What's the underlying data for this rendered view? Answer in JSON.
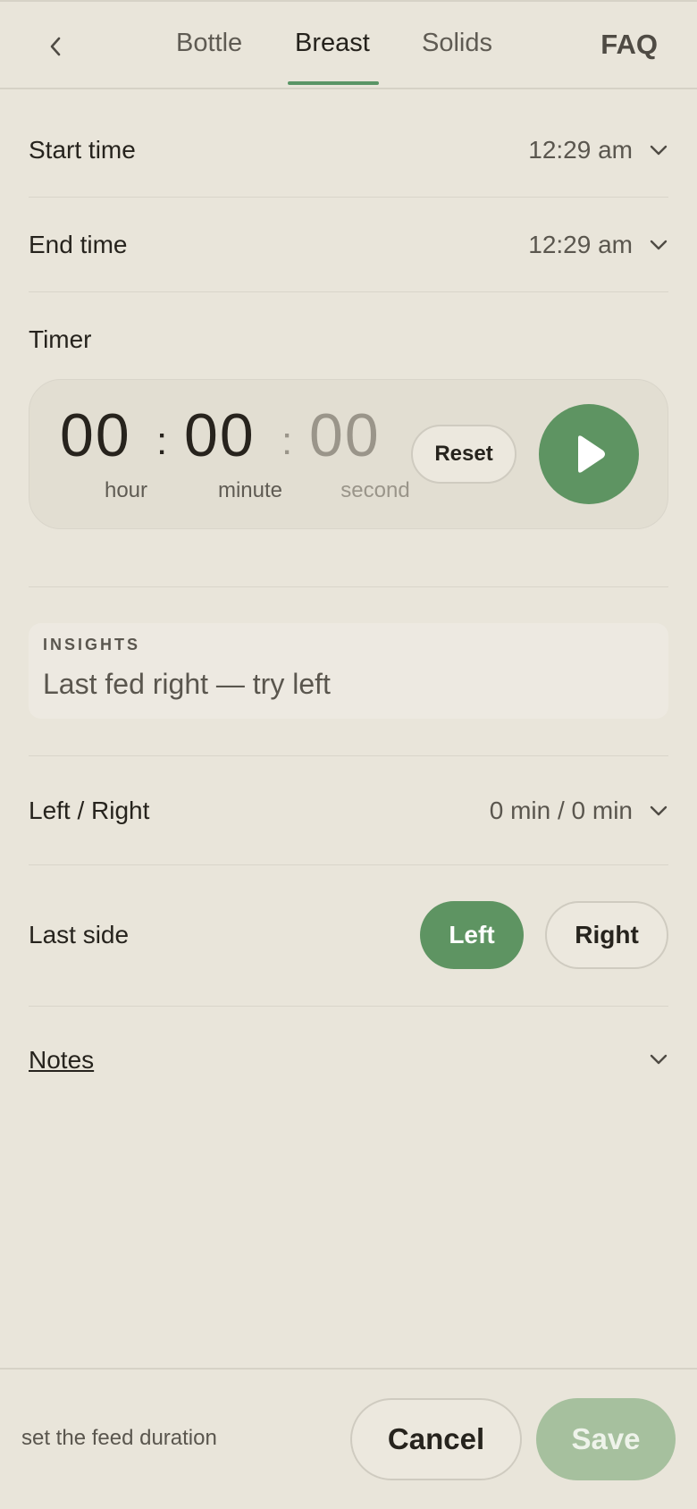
{
  "header": {
    "tabs": [
      {
        "label": "Bottle",
        "active": false
      },
      {
        "label": "Breast",
        "active": true
      },
      {
        "label": "Solids",
        "active": false
      }
    ],
    "faq_label": "FAQ"
  },
  "start_time": {
    "label": "Start time",
    "value": "12:29 am"
  },
  "end_time": {
    "label": "End time",
    "value": "12:29 am"
  },
  "timer": {
    "label": "Timer",
    "hours": "00",
    "minutes": "00",
    "seconds": "00",
    "hour_label": "hour",
    "minute_label": "minute",
    "second_label": "second",
    "reset_label": "Reset"
  },
  "insights": {
    "title": "INSIGHTS",
    "text": "Last fed right — try left"
  },
  "left_right": {
    "label": "Left / Right",
    "value": "0 min / 0 min"
  },
  "last_side": {
    "label": "Last side",
    "options": [
      "Left",
      "Right"
    ],
    "selected": "Left"
  },
  "notes": {
    "label": "Notes"
  },
  "footer": {
    "hint": "set the feed duration",
    "cancel_label": "Cancel",
    "save_label": "Save"
  },
  "colors": {
    "background": "#e9e5da",
    "accent_green": "#5e9462",
    "save_disabled": "#a6c09e"
  }
}
